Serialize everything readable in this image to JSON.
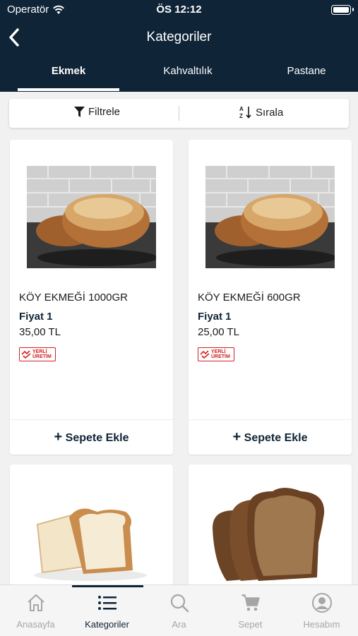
{
  "status": {
    "carrier": "Operatör",
    "time": "ÖS 12:12"
  },
  "nav": {
    "title": "Kategoriler"
  },
  "tabs": [
    "Ekmek",
    "Kahvaltılık",
    "Pastane"
  ],
  "toolbar": {
    "filter": "Filtrele",
    "sort": "Sırala"
  },
  "products": [
    {
      "name": "KÖY EKMEĞİ 1000GR",
      "label": "Fiyat 1",
      "price": "35,00 TL",
      "badge_line1": "YERLİ",
      "badge_line2": "ÜRETİM",
      "add": "Sepete Ekle"
    },
    {
      "name": "KÖY EKMEĞİ 600GR",
      "label": "Fiyat 1",
      "price": "25,00 TL",
      "badge_line1": "YERLİ",
      "badge_line2": "ÜRETİM",
      "add": "Sepete Ekle"
    }
  ],
  "tabbar": {
    "home": "Anasayfa",
    "categories": "Kategoriler",
    "search": "Ara",
    "cart": "Sepet",
    "account": "Hesabım"
  },
  "colors": {
    "navy": "#0f2437",
    "badge_red": "#d42020"
  }
}
